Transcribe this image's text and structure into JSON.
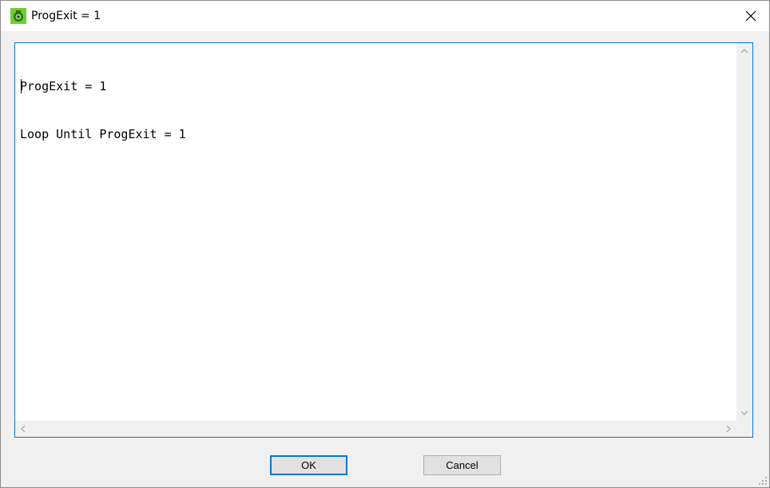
{
  "window": {
    "title": "ProgExit = 1",
    "icon": "app-icon",
    "close_icon": "close-icon"
  },
  "editor": {
    "lines": [
      "ProgExit = 1",
      "Loop Until ProgExit = 1"
    ],
    "border_color": "#0078d7"
  },
  "buttons": {
    "ok_label": "OK",
    "cancel_label": "Cancel"
  },
  "icons": {
    "scroll_up": "chevron-up-icon",
    "scroll_down": "chevron-down-icon",
    "scroll_left": "chevron-left-icon",
    "scroll_right": "chevron-right-icon",
    "resize_grip": "resize-grip-icon"
  }
}
